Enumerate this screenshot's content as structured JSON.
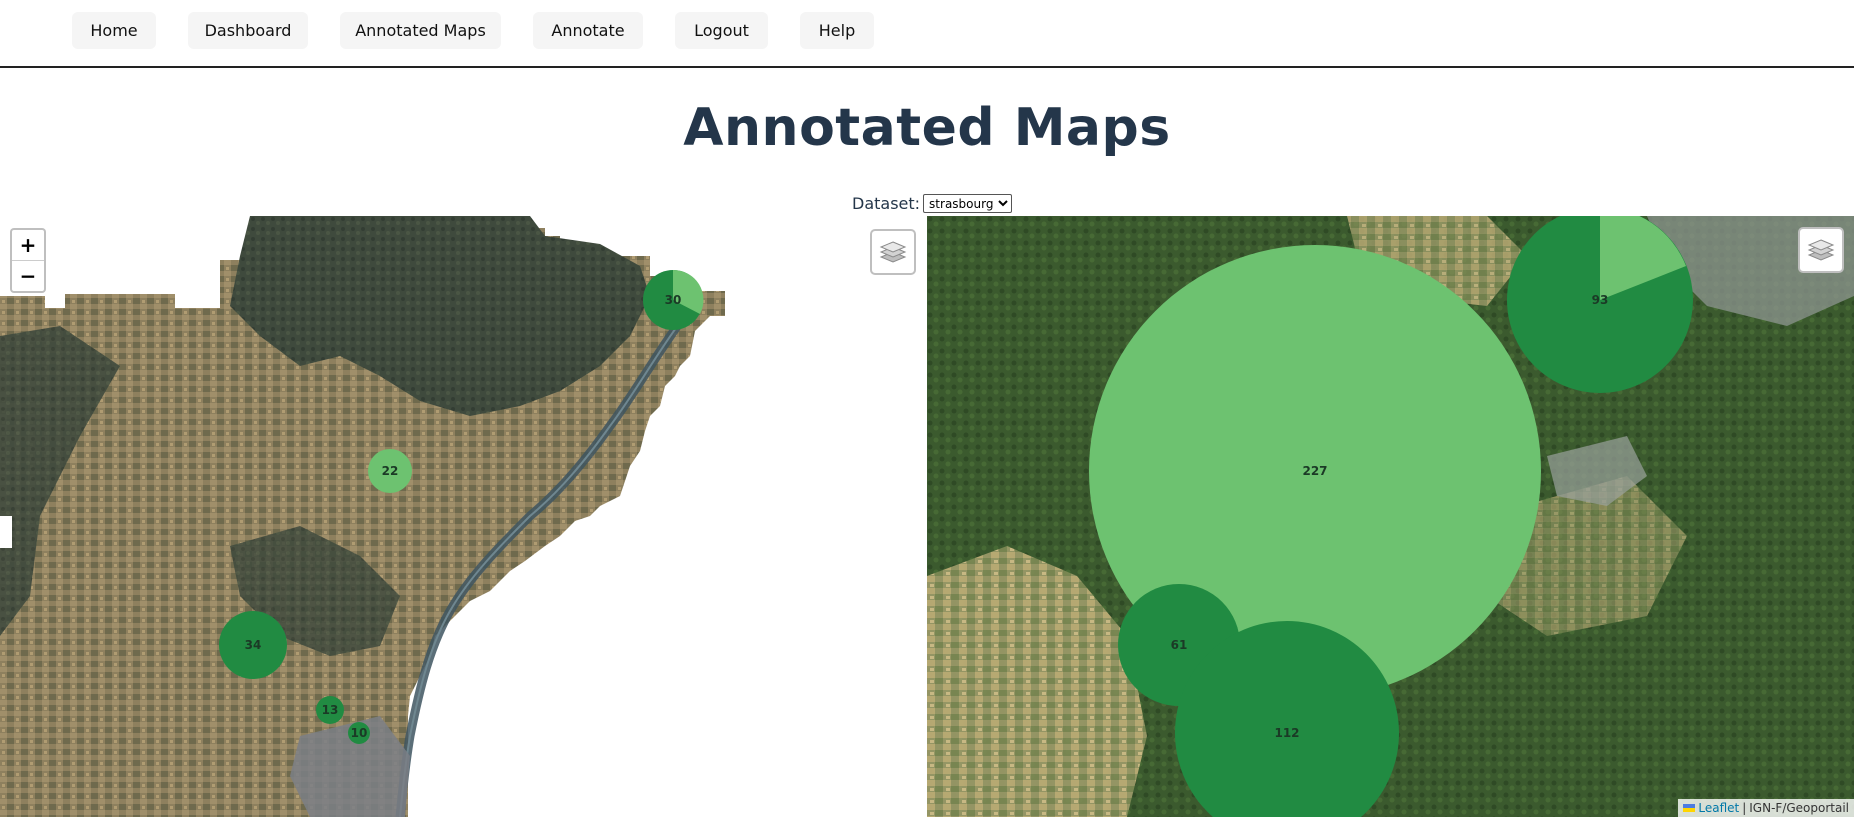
{
  "nav": {
    "items": [
      {
        "label": "Home"
      },
      {
        "label": "Dashboard"
      },
      {
        "label": "Annotated Maps"
      },
      {
        "label": "Annotate"
      },
      {
        "label": "Logout"
      },
      {
        "label": "Help"
      }
    ]
  },
  "page_title": "Annotated Maps",
  "dataset": {
    "label": "Dataset:",
    "selected": "strasbourg"
  },
  "colors": {
    "cluster_dark": "#218b42",
    "cluster_light": "#6dc270",
    "title": "#24364a"
  },
  "left_map": {
    "zoom_in": "+",
    "zoom_out": "−",
    "clusters": [
      {
        "count": "30"
      },
      {
        "count": "22"
      },
      {
        "count": "34"
      },
      {
        "count": "13"
      },
      {
        "count": "10"
      }
    ]
  },
  "right_map": {
    "clusters": [
      {
        "count": "227"
      },
      {
        "count": "93"
      },
      {
        "count": "61"
      },
      {
        "count": "112"
      }
    ],
    "attribution": {
      "leaflet": "Leaflet",
      "separator": "|",
      "source": "IGN-F/Geoportail"
    }
  },
  "icons": {
    "layers": "layers-icon",
    "flag": "ukraine-flag-icon"
  }
}
